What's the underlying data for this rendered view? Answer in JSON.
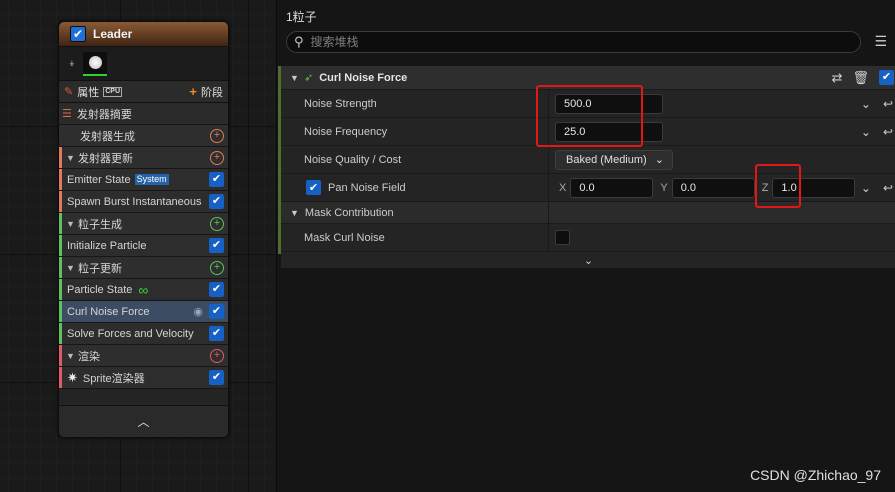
{
  "node": {
    "title": "Leader",
    "tabs": {
      "properties": "属性",
      "cpu": "CPU",
      "stage": "阶段"
    },
    "summary": "发射器摘要",
    "groups": [
      {
        "label": "发射器生成",
        "type": "sub",
        "accent": "#e07a5a"
      },
      {
        "label": "发射器更新",
        "type": "group",
        "accent": "#e07a5a"
      },
      {
        "label": "Emitter State",
        "badge": "System",
        "type": "item",
        "accent": "#e07a5a"
      },
      {
        "label": "Spawn Burst Instantaneous",
        "type": "item",
        "accent": "#e07a5a"
      },
      {
        "label": "粒子生成",
        "type": "group",
        "accent": "#5cc25c"
      },
      {
        "label": "Initialize Particle",
        "type": "item",
        "accent": "#5cc25c"
      },
      {
        "label": "粒子更新",
        "type": "group",
        "accent": "#5cc25c"
      },
      {
        "label": "Particle State",
        "type": "item",
        "accent": "#5cc25c"
      },
      {
        "label": "Curl Noise Force",
        "type": "item",
        "accent": "#5cc25c",
        "selected": true
      },
      {
        "label": "Solve Forces and Velocity",
        "type": "item",
        "accent": "#5cc25c"
      },
      {
        "label": "渲染",
        "type": "group",
        "accent": "#e05a6a"
      },
      {
        "label": "Sprite渲染器",
        "type": "item",
        "accent": "#e05a6a"
      }
    ]
  },
  "panel": {
    "title": "1粒子",
    "search_placeholder": "搜索堆栈",
    "section_title": "Curl Noise Force",
    "props": {
      "noise_strength_label": "Noise Strength",
      "noise_strength_value": "500.0",
      "noise_frequency_label": "Noise Frequency",
      "noise_frequency_value": "25.0",
      "noise_quality_label": "Noise Quality / Cost",
      "noise_quality_value": "Baked (Medium)",
      "pan_noise_label": "Pan Noise Field",
      "pan_x_label": "X",
      "pan_x": "0.0",
      "pan_y_label": "Y",
      "pan_y": "0.0",
      "pan_z_label": "Z",
      "pan_z": "1.0",
      "mask_contribution_label": "Mask Contribution",
      "mask_curl_noise_label": "Mask Curl Noise"
    }
  },
  "watermark": "CSDN @Zhichao_97",
  "colors": {
    "highlight_box": "#e01818",
    "checkbox": "#1760c5",
    "section_accent": "#4e6e2e"
  }
}
